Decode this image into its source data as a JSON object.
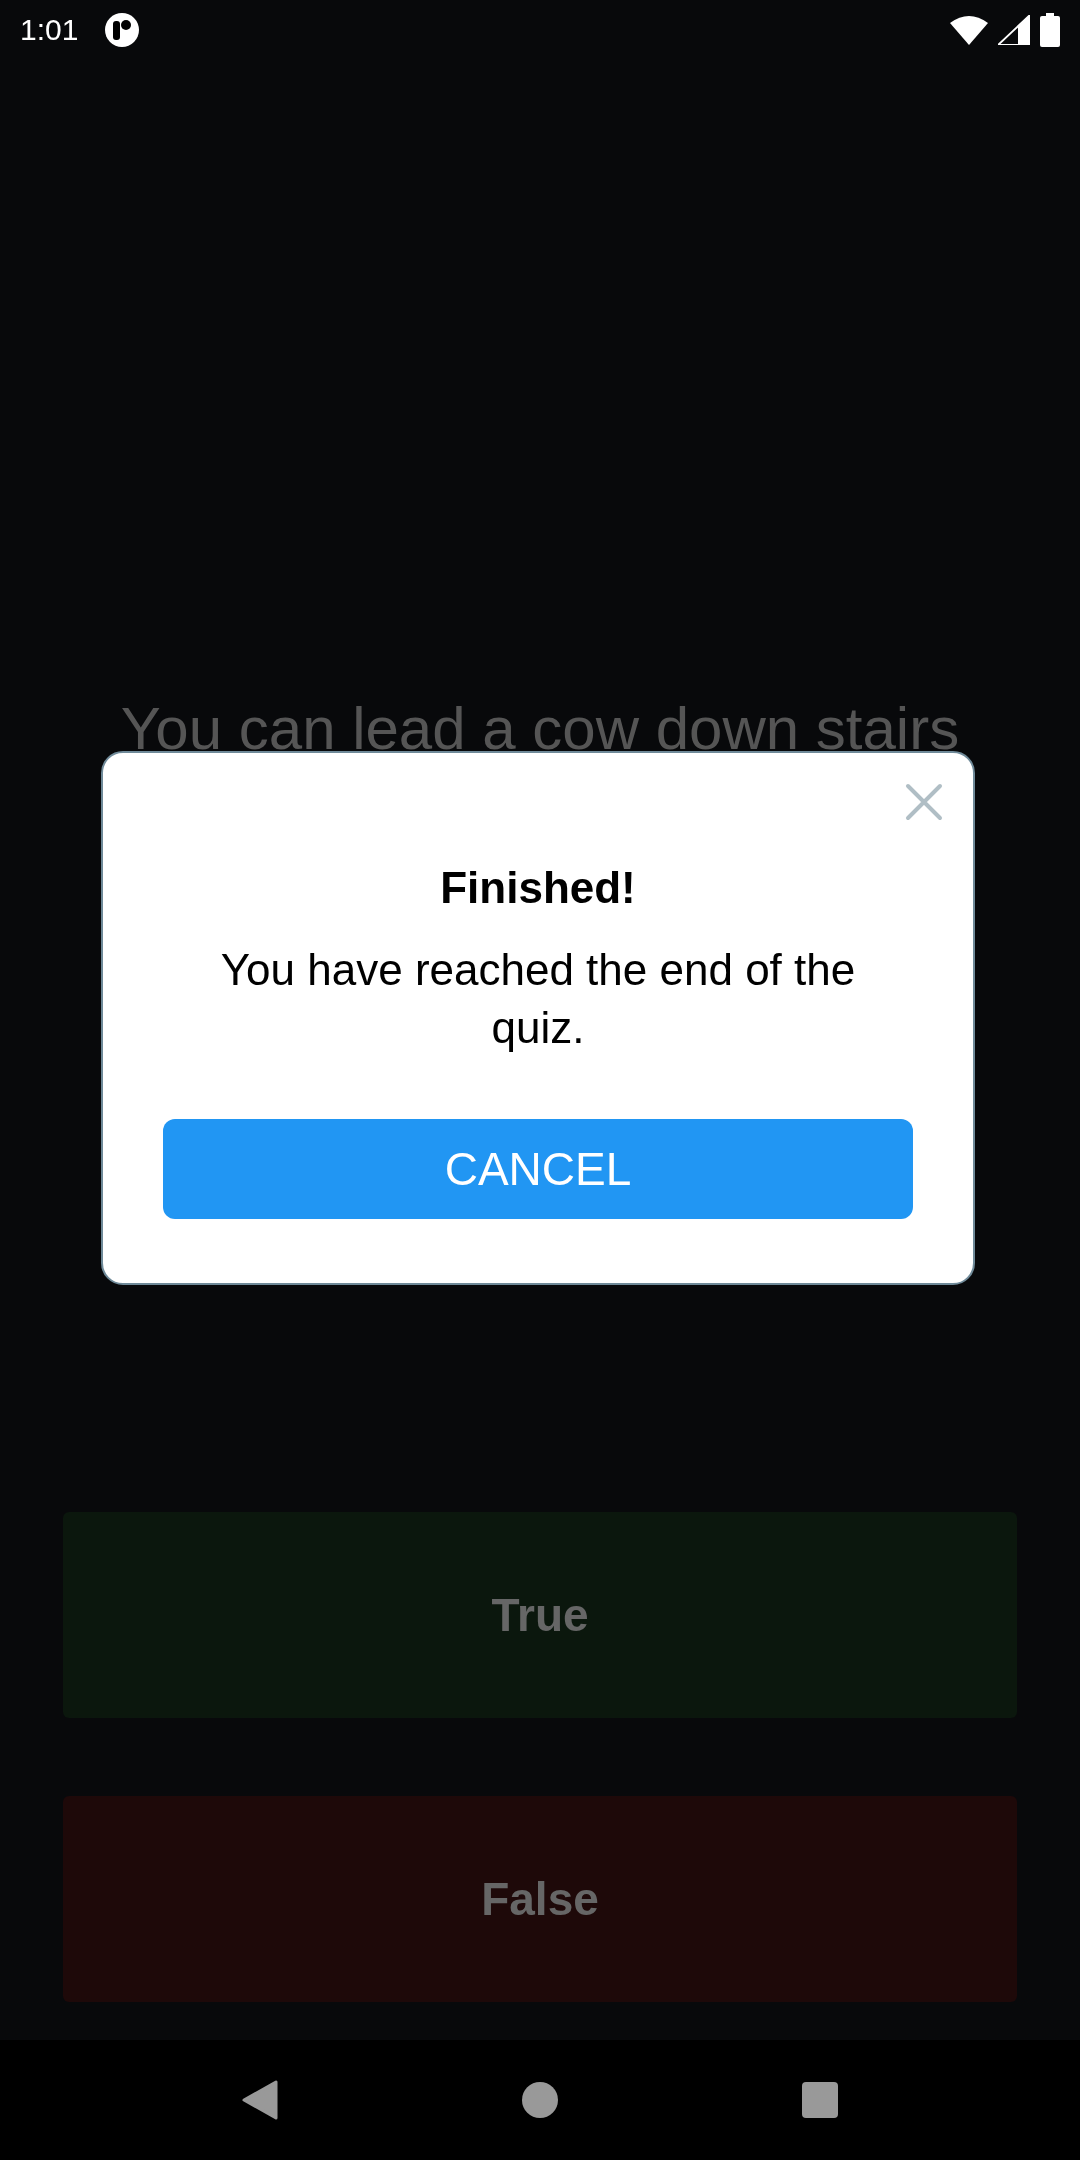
{
  "status_bar": {
    "time": "1:01"
  },
  "question": "You can lead a cow down stairs",
  "answers": [
    {
      "label": "True",
      "color": "#0b170d"
    },
    {
      "label": "False",
      "color": "#1e0909"
    }
  ],
  "dialog": {
    "title": "Finished!",
    "message": "You have reached the end of the quiz.",
    "button": "CANCEL"
  }
}
